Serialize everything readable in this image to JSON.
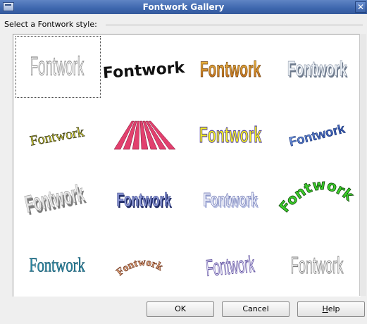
{
  "window": {
    "title": "Fontwork Gallery",
    "close_glyph": "✕"
  },
  "section": {
    "label": "Select a Fontwork style:"
  },
  "gallery": {
    "item_text": "Fontwork",
    "selected_index": 0,
    "items": [
      {
        "style": "outline-condensed"
      },
      {
        "style": "black-wave"
      },
      {
        "style": "gold-gradient"
      },
      {
        "style": "silver-3d"
      },
      {
        "style": "olive-serif-arc"
      },
      {
        "style": "pink-perspective"
      },
      {
        "style": "yellow-bold"
      },
      {
        "style": "blue-slant"
      },
      {
        "style": "grey-3d-curve"
      },
      {
        "style": "navy-3d"
      },
      {
        "style": "lavender-blur"
      },
      {
        "style": "green-arch"
      },
      {
        "style": "teal-serif-wave"
      },
      {
        "style": "brown-arch"
      },
      {
        "style": "lavender-outline-wave"
      },
      {
        "style": "white-outline"
      }
    ]
  },
  "buttons": {
    "ok": "OK",
    "cancel": "Cancel",
    "help_accel": "H",
    "help_rest": "elp"
  },
  "colors": {
    "titlebar": "#3d66ad",
    "gold": "#d79a2a",
    "yellow": "#f2ee1d",
    "green": "#3ccd2a",
    "blue": "#3358b8",
    "pink": "#e2406e",
    "teal": "#2a8aa6"
  }
}
